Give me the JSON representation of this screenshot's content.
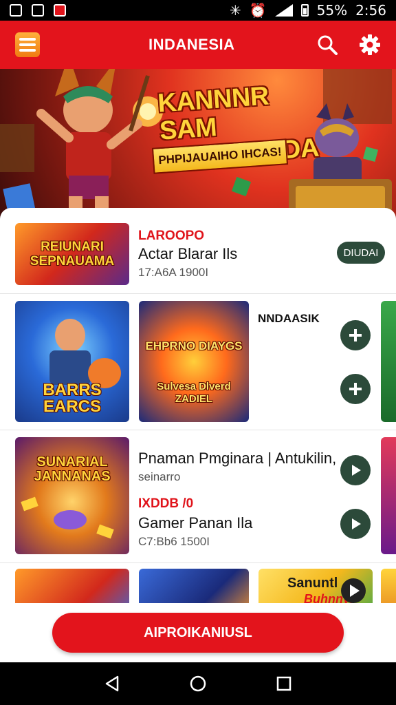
{
  "status_bar": {
    "battery": "55%",
    "time": "2:56"
  },
  "header": {
    "title": "INDANESIA"
  },
  "hero": {
    "title_line1": "KANNNR SAM",
    "title_line2": "PAMHIMADA",
    "subtitle": "PHPIJAUAIHO IHCAS!"
  },
  "list": {
    "row1": {
      "thumb_text": "REIUNARI SEPNAUAMA",
      "label": "LAROOPO",
      "title": "Actar Blarar Ils",
      "meta": "17:A6A 1900I",
      "pill": "DIUDAI"
    },
    "row2": {
      "thumb1_text": "BARRS EARCS",
      "thumb2_text_top": "EHPRNO DIAYGS",
      "thumb2_text_bottom": "Sulvesa Dlverd ZADIEL",
      "heading": "NNDAASIK"
    },
    "row3": {
      "thumb_text": "SUNARIAL JANNANAS",
      "title": "Pnaman Pmginara | Antukilin,",
      "subtitle": "seinarro",
      "label": "IXDDB /0",
      "title2": "Gamer Panan Ila",
      "meta": "C7:Bb6 1500I"
    },
    "row4": {
      "thumb3_text_top": "Sanuntl",
      "thumb3_text_bottom": "Buhnnyl"
    }
  },
  "cta": {
    "label": "AIPROIKANIUSL"
  },
  "colors": {
    "brand_red": "#e3141c",
    "button_dark_green": "#2c4a3a"
  }
}
